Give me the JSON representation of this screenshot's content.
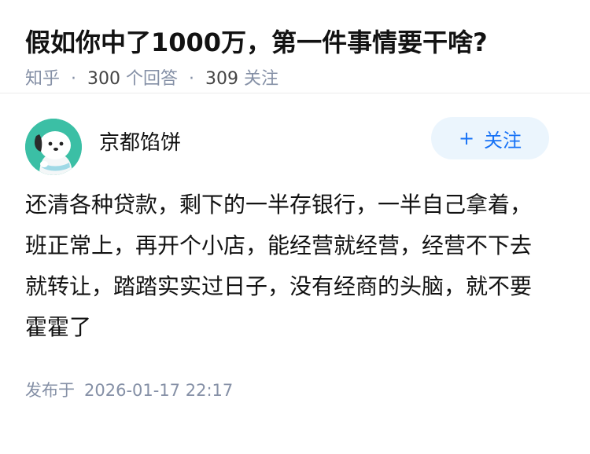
{
  "question": {
    "title": "假如你中了1000万，第一件事情要干啥?",
    "source": "知乎",
    "answer_count": "300",
    "answer_label": "个回答",
    "follower_count": "309",
    "follower_label": "关注"
  },
  "answer": {
    "author": {
      "name": "京都馅饼",
      "avatar_icon": "cartoon-dog-avatar-icon"
    },
    "follow_button": {
      "plus": "+",
      "label": "关注"
    },
    "content": "还清各种贷款，剩下的一半存银行，一半自己拿着，班正常上，再开个小店，能经营就经营，经营不下去就转让，踏踏实实过日子，没有经商的头脑，就不要霍霍了",
    "published_label": "发布于",
    "published_time": "2026-01-17 22:17"
  },
  "colors": {
    "meta_gray": "#8590a6",
    "follow_bg": "#ebf5fd",
    "follow_text": "#1772f6",
    "avatar_bg": "#3bbfa5"
  }
}
